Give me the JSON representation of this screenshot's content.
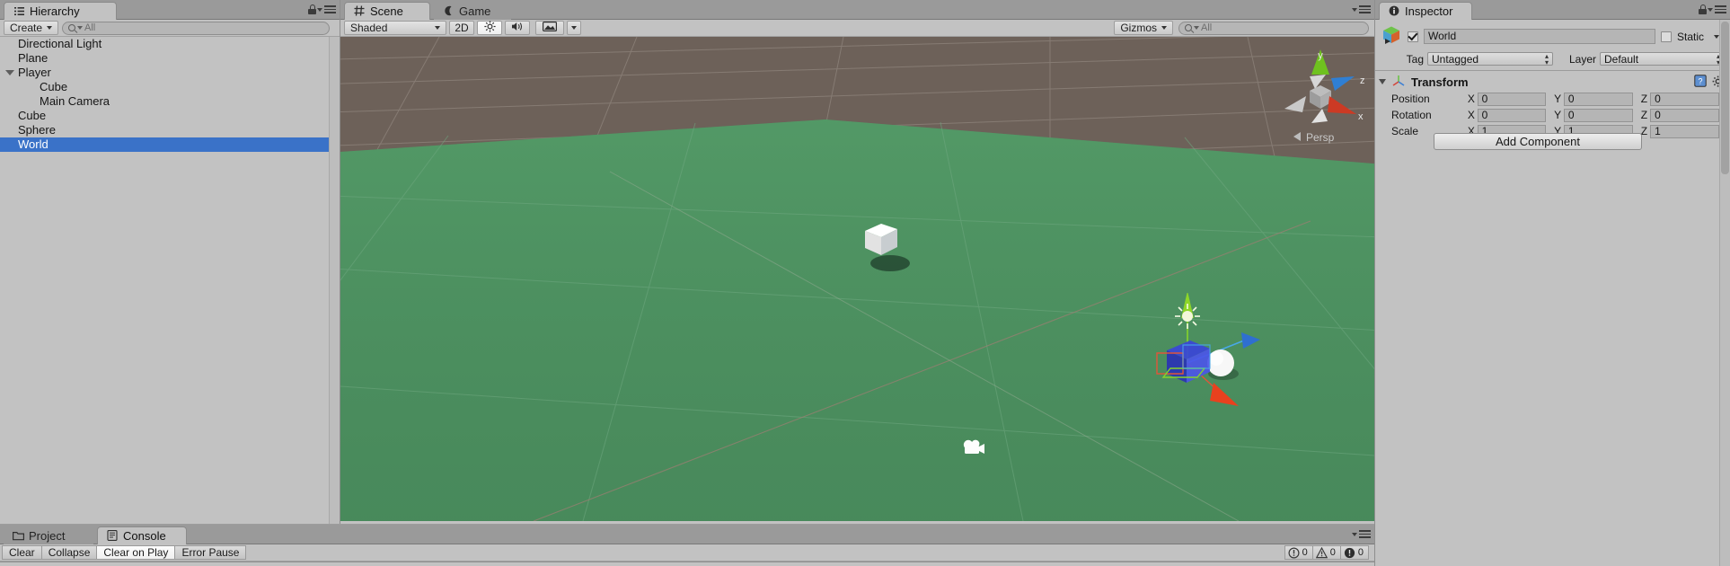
{
  "app": {
    "title": "Unity Editor"
  },
  "hierarchy": {
    "tab_label": "Hierarchy",
    "tab_icon": "hierarchy-icon",
    "lock_icon": "lock-icon",
    "menu_icon": "hamburger-menu-icon",
    "create_label": "Create",
    "search": {
      "value": "",
      "placeholder": "All",
      "icon": "search-icon"
    },
    "items": [
      {
        "label": "Directional Light",
        "indent": 1,
        "expandable": false,
        "selected": false
      },
      {
        "label": "Plane",
        "indent": 1,
        "expandable": false,
        "selected": false
      },
      {
        "label": "Player",
        "indent": 1,
        "expandable": true,
        "expanded": true,
        "selected": false
      },
      {
        "label": "Cube",
        "indent": 2,
        "expandable": false,
        "selected": false
      },
      {
        "label": "Main Camera",
        "indent": 2,
        "expandable": false,
        "selected": false
      },
      {
        "label": "Cube",
        "indent": 1,
        "expandable": false,
        "selected": false
      },
      {
        "label": "Sphere",
        "indent": 1,
        "expandable": false,
        "selected": false
      },
      {
        "label": "World",
        "indent": 1,
        "expandable": false,
        "selected": true
      }
    ],
    "selection_color": "#3a72c8"
  },
  "scene_panel": {
    "tabs": [
      {
        "label": "Scene",
        "icon": "grid-icon",
        "active": true
      },
      {
        "label": "Game",
        "icon": "gamepad-icon",
        "active": false
      }
    ],
    "menu_icon": "hamburger-menu-icon",
    "toolbar": {
      "draw_mode": "Shaded",
      "view_mode_2d": "2D",
      "lighting_icon": "sun-icon",
      "audio_icon": "speaker-icon",
      "fx_icon": "image-effects-icon",
      "fx_dropdown_icon": "chevron-down-icon",
      "gizmos_label": "Gizmos",
      "search": {
        "value": "",
        "placeholder": "All",
        "icon": "search-icon"
      }
    },
    "viewport": {
      "background_color": "#6d6159",
      "ground_color": "#4d9060",
      "axis_gizmo": {
        "labels": [
          "y",
          "z",
          "x"
        ],
        "colors": {
          "x": "#cc3a24",
          "y": "#7fcc1f",
          "z": "#2f7fd4"
        },
        "projection_label": "Persp",
        "projection_icon": "chevron-left-icon"
      },
      "objects": [
        {
          "name": "white-cube",
          "type": "cube"
        },
        {
          "name": "blue-cube",
          "type": "cube"
        },
        {
          "name": "white-sphere",
          "type": "sphere"
        },
        {
          "name": "directional-light-gizmo",
          "type": "light"
        },
        {
          "name": "main-camera-gizmo",
          "type": "camera"
        }
      ],
      "transform_gizmo": {
        "axes": [
          "x",
          "y",
          "z"
        ],
        "colors": {
          "x": "#e03a20",
          "y": "#8ed628",
          "z": "#2f7fd4"
        }
      }
    }
  },
  "inspector": {
    "tab_label": "Inspector",
    "tab_icon": "info-icon",
    "lock_icon": "lock-icon",
    "menu_icon": "hamburger-menu-icon",
    "object_icon": "gameobject-cube-icon",
    "enabled": true,
    "name": "World",
    "static_label": "Static",
    "static_checked": false,
    "static_dropdown_icon": "chevron-down-icon",
    "tag_label": "Tag",
    "tag_value": "Untagged",
    "layer_label": "Layer",
    "layer_value": "Default",
    "component": {
      "title": "Transform",
      "icon": "transform-axis-icon",
      "foldout_icon": "triangle-down-icon",
      "help_icon": "help-book-icon",
      "settings_icon": "gear-icon",
      "rows": [
        {
          "label": "Position",
          "x": "0",
          "y": "0",
          "z": "0"
        },
        {
          "label": "Rotation",
          "x": "0",
          "y": "0",
          "z": "0"
        },
        {
          "label": "Scale",
          "x": "1",
          "y": "1",
          "z": "1"
        }
      ],
      "axis_labels": [
        "X",
        "Y",
        "Z"
      ]
    },
    "add_component_label": "Add Component"
  },
  "console_panel": {
    "tabs": [
      {
        "label": "Project",
        "icon": "folder-icon",
        "active": false
      },
      {
        "label": "Console",
        "icon": "console-icon",
        "active": true
      }
    ],
    "menu_icon": "hamburger-menu-icon",
    "buttons": [
      {
        "label": "Clear",
        "toggled": false
      },
      {
        "label": "Collapse",
        "toggled": false
      },
      {
        "label": "Clear on Play",
        "toggled": true
      },
      {
        "label": "Error Pause",
        "toggled": false
      }
    ],
    "counters": [
      {
        "icon": "info-circle-icon",
        "count": "0"
      },
      {
        "icon": "warning-triangle-icon",
        "count": "0"
      },
      {
        "icon": "error-circle-icon",
        "count": "0"
      }
    ]
  }
}
